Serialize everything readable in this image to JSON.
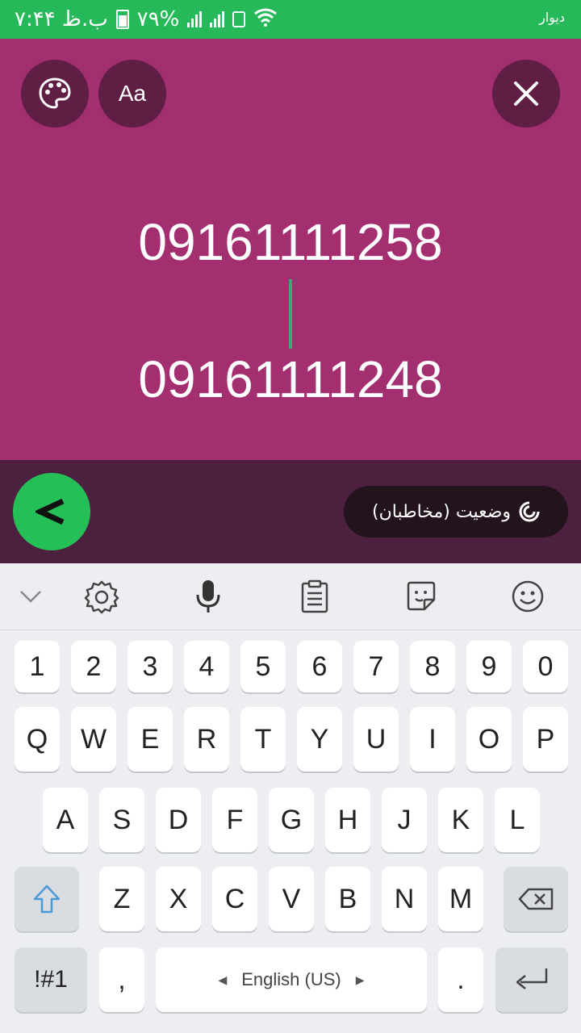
{
  "status_bar": {
    "time": "۷:۴۴ ب.ظ",
    "battery": "۷۹%",
    "app_label": "دیوار"
  },
  "composer": {
    "font_button_label": "Aa",
    "line1": "09161111258",
    "line2": "09161111248"
  },
  "actionbar": {
    "audience_label": "وضعیت (مخاطبان)"
  },
  "keyboard": {
    "row_numbers": [
      "1",
      "2",
      "3",
      "4",
      "5",
      "6",
      "7",
      "8",
      "9",
      "0"
    ],
    "row_q": [
      "Q",
      "W",
      "E",
      "R",
      "T",
      "Y",
      "U",
      "I",
      "O",
      "P"
    ],
    "row_a": [
      "A",
      "S",
      "D",
      "F",
      "G",
      "H",
      "J",
      "K",
      "L"
    ],
    "row_z": [
      "Z",
      "X",
      "C",
      "V",
      "B",
      "N",
      "M"
    ],
    "symbols_label": "!#1",
    "comma_label": ",",
    "space_label": "English (US)",
    "period_label": "."
  },
  "colors": {
    "status_bar": "#26b95a",
    "background": "#a42f70",
    "send_button": "#25bf58"
  }
}
